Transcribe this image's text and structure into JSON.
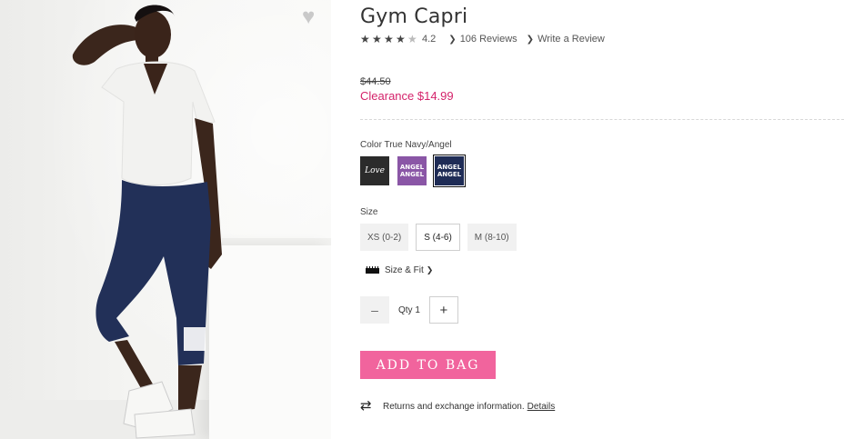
{
  "product": {
    "title": "Gym Capri",
    "rating_value": "4.2",
    "reviews_label": "106 Reviews",
    "write_review_label": "Write a Review",
    "original_price": "$44.50",
    "sale_price": "Clearance $14.99"
  },
  "color": {
    "label": "Color True Navy/Angel",
    "swatches": [
      {
        "name": "black",
        "text": "Love",
        "color": "#2b2b2b"
      },
      {
        "name": "purple",
        "text": "ANGEL ANGEL",
        "color": "#8a56a6"
      },
      {
        "name": "navy",
        "text": "ANGEL ANGEL",
        "color": "#1f2c56",
        "selected": true
      }
    ]
  },
  "size": {
    "label": "Size",
    "options": [
      "XS (0-2)",
      "S (4-6)",
      "M (8-10)"
    ],
    "selected": "S (4-6)",
    "size_fit_label": "Size & Fit"
  },
  "quantity": {
    "minus": "–",
    "label": "Qty 1",
    "plus": "+"
  },
  "cta": {
    "add_to_bag": "ADD TO BAG"
  },
  "returns": {
    "text": "Returns and exchange information.",
    "link": "Details"
  },
  "icons": {
    "wishlist": "heart-icon",
    "ruler": "ruler-icon",
    "returns": "exchange-arrows-icon"
  },
  "colors": {
    "accent": "#f1649d",
    "sale": "#d4236b"
  }
}
